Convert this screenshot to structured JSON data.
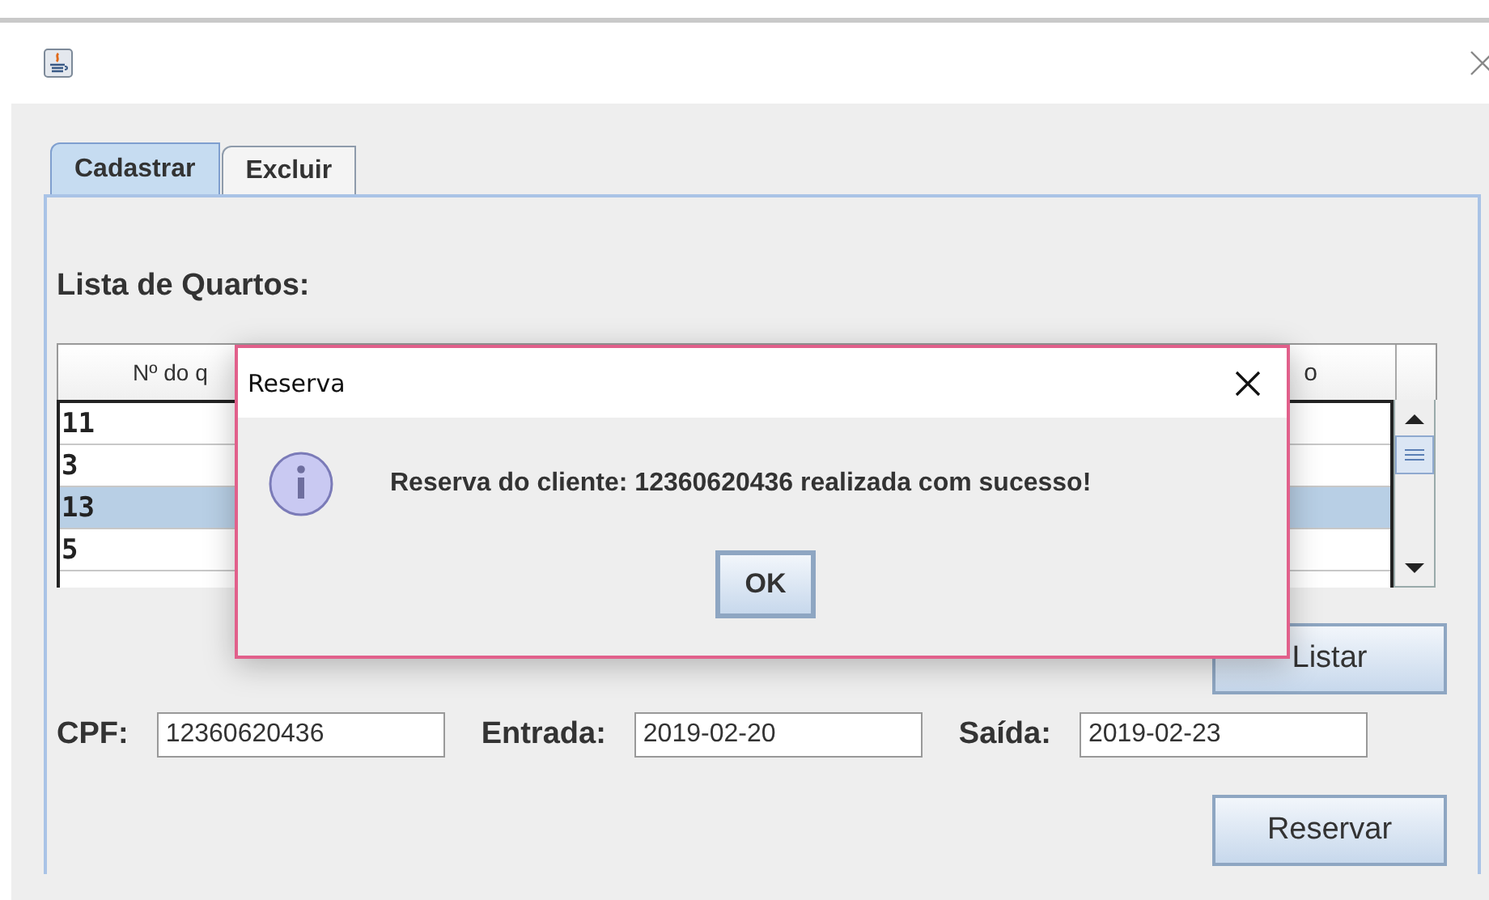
{
  "tabs": [
    {
      "label": "Cadastrar",
      "selected": true
    },
    {
      "label": "Excluir",
      "selected": false
    }
  ],
  "list_title": "Lista de Quartos:",
  "table": {
    "columns": [
      {
        "label": "Nº do q"
      },
      {},
      {},
      {
        "label": "o"
      }
    ],
    "rows": [
      {
        "cell": "11",
        "selected": false
      },
      {
        "cell": "3",
        "selected": false
      },
      {
        "cell": "13",
        "selected": true
      },
      {
        "cell": "5",
        "selected": false
      }
    ]
  },
  "list_button": "Listar",
  "fields": [
    {
      "label": "CPF:",
      "value": "12360620436"
    },
    {
      "label": "Entrada:",
      "value": "2019-02-20"
    },
    {
      "label": "Saída:",
      "value": "2019-02-23"
    }
  ],
  "reserve_button": "Reservar",
  "dialog": {
    "title": "Reserva",
    "message": "Reserva do cliente: 12360620436 realizada com sucesso!",
    "button": "OK"
  }
}
